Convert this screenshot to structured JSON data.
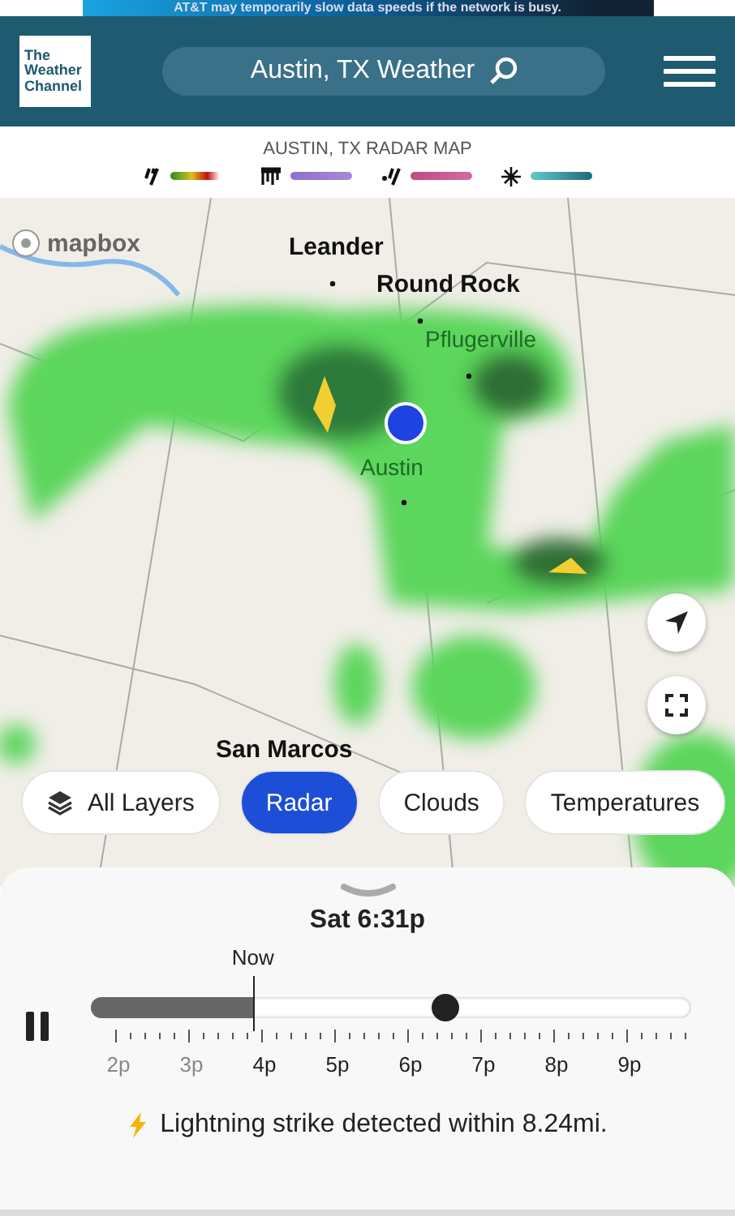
{
  "ad_banner": {
    "text": "AT&T may temporarily slow data speeds if the network is busy."
  },
  "header": {
    "logo": [
      "The",
      "Weather",
      "Channel"
    ],
    "search": {
      "value": "Austin, TX Weather"
    }
  },
  "radar_legend": {
    "title": "AUSTIN, TX RADAR MAP",
    "items": [
      {
        "kind": "rain"
      },
      {
        "kind": "ice"
      },
      {
        "kind": "mix"
      },
      {
        "kind": "snow"
      }
    ]
  },
  "map": {
    "attribution": "mapbox",
    "places": [
      {
        "name": "Leander",
        "kind": "town"
      },
      {
        "name": "Round Rock",
        "kind": "town"
      },
      {
        "name": "Pflugerville",
        "kind": "suburb"
      },
      {
        "name": "Austin",
        "kind": "suburb"
      },
      {
        "name": "San Marcos",
        "kind": "town"
      }
    ]
  },
  "layers": [
    {
      "label": "All Layers",
      "kind": "menu",
      "selected": false
    },
    {
      "label": "Radar",
      "kind": "layer",
      "selected": true
    },
    {
      "label": "Clouds",
      "kind": "layer",
      "selected": false
    },
    {
      "label": "Temperatures",
      "kind": "layer",
      "selected": false
    }
  ],
  "timeline": {
    "time": "Sat 6:31p",
    "now_label": "Now",
    "playing": true,
    "level": 0.59,
    "ticks": [
      {
        "label": "2p",
        "past": true
      },
      {
        "label": "3p",
        "past": true
      },
      {
        "label": "4p",
        "past": false
      },
      {
        "label": "5p",
        "past": false
      },
      {
        "label": "6p",
        "past": false
      },
      {
        "label": "7p",
        "past": false
      },
      {
        "label": "8p",
        "past": false
      },
      {
        "label": "9p",
        "past": false
      }
    ]
  },
  "alert": {
    "text": "Lightning strike detected within 8.24mi."
  }
}
